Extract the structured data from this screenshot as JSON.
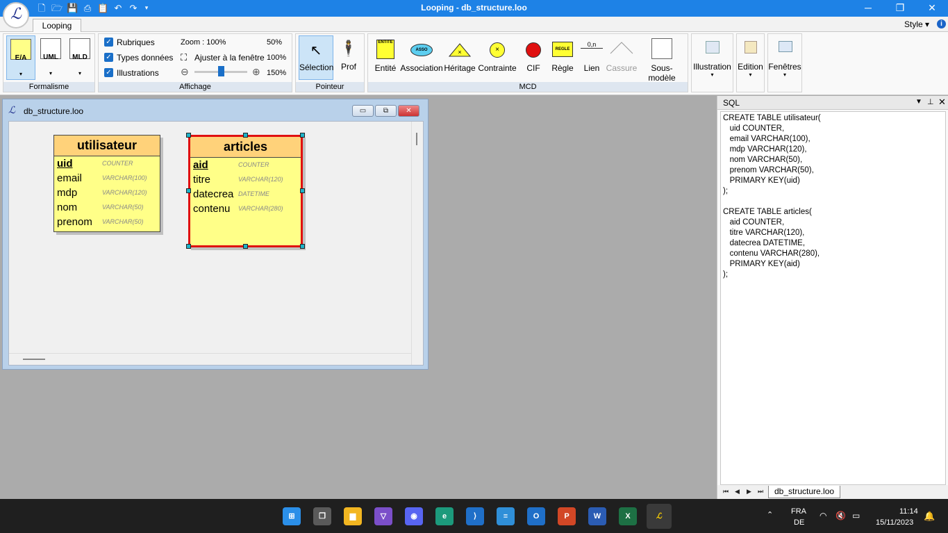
{
  "app": {
    "title": "Looping - db_structure.loo",
    "logo_text": "ℒ",
    "window_controls": {
      "minimize": "─",
      "maximize": "❐",
      "close": "✕"
    }
  },
  "ribbon": {
    "tab": "Looping",
    "style_menu": "Style ▾",
    "help": "i",
    "groups": {
      "formalisme": {
        "label": "Formalisme",
        "buttons": [
          "E/A",
          "UML",
          "MLD"
        ]
      },
      "affichage": {
        "label": "Affichage",
        "checkboxes": [
          "Rubriques",
          "Types données",
          "Illustrations"
        ],
        "zoom_label": "Zoom : 100%",
        "zoom_50": "50%",
        "fit_label": "Ajuster à la fenêtre",
        "zoom_100": "100%",
        "zoom_150": "150%",
        "zoom_level": 0.5
      },
      "pointeur": {
        "label": "Pointeur",
        "selection": "Sélection",
        "prof": "Prof"
      },
      "mcd": {
        "label": "MCD",
        "buttons": [
          "Entité",
          "Association",
          "Héritage",
          "Contrainte",
          "CIF",
          "Règle",
          "Lien",
          "Cassure",
          "Sous-modèle"
        ],
        "icon_labels": {
          "entite": "ENTITE",
          "asso": "ASSO",
          "regle": "REGLE",
          "lien": "0,n"
        }
      },
      "illustration": "Illustration",
      "edition": "Edition",
      "fenetres": "Fenêtres"
    }
  },
  "document": {
    "title": "db_structure.loo",
    "entities": [
      {
        "name": "utilisateur",
        "fields": [
          {
            "name": "uid",
            "type": "COUNTER",
            "pk": true
          },
          {
            "name": "email",
            "type": "VARCHAR(100)",
            "pk": false
          },
          {
            "name": "mdp",
            "type": "VARCHAR(120)",
            "pk": false
          },
          {
            "name": "nom",
            "type": "VARCHAR(50)",
            "pk": false
          },
          {
            "name": "prenom",
            "type": "VARCHAR(50)",
            "pk": false
          }
        ]
      },
      {
        "name": "articles",
        "selected": true,
        "fields": [
          {
            "name": "aid",
            "type": "COUNTER",
            "pk": true
          },
          {
            "name": "titre",
            "type": "VARCHAR(120)",
            "pk": false
          },
          {
            "name": "datecrea",
            "type": "DATETIME",
            "pk": false
          },
          {
            "name": "contenu",
            "type": "VARCHAR(280)",
            "pk": false
          }
        ]
      }
    ]
  },
  "sql_panel": {
    "title": "SQL",
    "code": "CREATE TABLE utilisateur(\n   uid COUNTER,\n   email VARCHAR(100),\n   mdp VARCHAR(120),\n   nom VARCHAR(50),\n   prenom VARCHAR(50),\n   PRIMARY KEY(uid)\n);\n\nCREATE TABLE articles(\n   aid COUNTER,\n   titre VARCHAR(120),\n   datecrea DATETIME,\n   contenu VARCHAR(280),\n   PRIMARY KEY(aid)\n);",
    "tab": "db_structure.loo"
  },
  "taskbar": {
    "lang": "FRA",
    "layout": "DE",
    "time": "11:14",
    "date": "15/11/2023"
  },
  "colors": {
    "titlebar": "#1e82e6",
    "entity_fill": "#ffff88",
    "entity_head": "#ffd27a",
    "selection": "#e01010"
  }
}
